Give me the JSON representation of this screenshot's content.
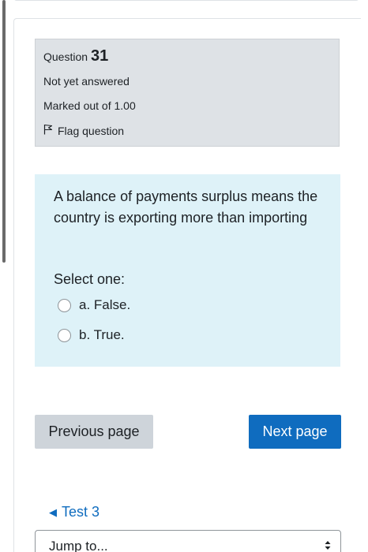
{
  "question_info": {
    "label": "Question",
    "number": "31",
    "state": "Not yet answered",
    "grade": "Marked out of 1.00",
    "flag_label": "Flag question"
  },
  "question": {
    "text": "A balance of payments surplus means the country is exporting more than importing",
    "prompt": "Select one:",
    "options": [
      {
        "label": "a. False."
      },
      {
        "label": "b. True."
      }
    ]
  },
  "navigation": {
    "previous_label": "Previous page",
    "next_label": "Next page",
    "back_link_label": "Test 3",
    "jump_label": "Jump to..."
  },
  "colors": {
    "info_bg": "#dee2e6",
    "content_bg": "#def2f8",
    "primary": "#0f6cbf",
    "secondary_button": "#ced4da"
  },
  "icons": {
    "flag": "flag-outline-icon",
    "back": "left-triangle-icon",
    "select": "up-down-arrows-icon"
  }
}
